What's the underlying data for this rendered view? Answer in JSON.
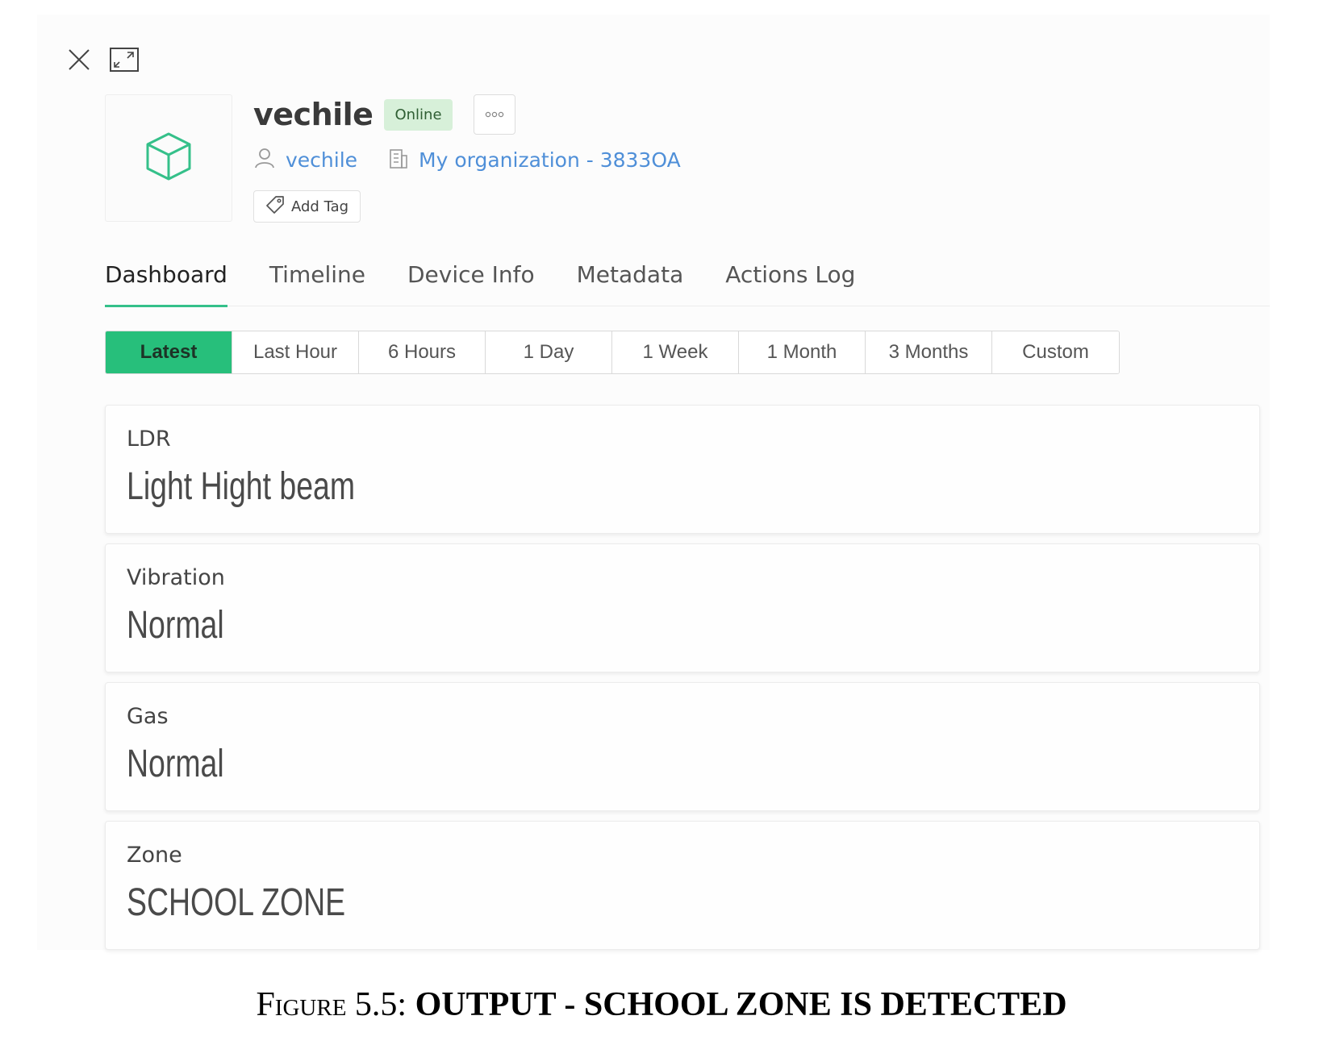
{
  "window": {
    "controls": [
      {
        "icon": "close-icon"
      },
      {
        "icon": "expand-icon"
      }
    ]
  },
  "device": {
    "icon": "cube-icon",
    "name": "vechile",
    "status": "Online",
    "more_icon": "more-icon",
    "owner": "vechile",
    "organization": "My organization - 3833OA",
    "add_tag": "Add Tag"
  },
  "tabs": [
    {
      "label": "Dashboard",
      "active": true
    },
    {
      "label": "Timeline",
      "active": false
    },
    {
      "label": "Device Info",
      "active": false
    },
    {
      "label": "Metadata",
      "active": false
    },
    {
      "label": "Actions Log",
      "active": false
    }
  ],
  "time_ranges": [
    {
      "label": "Latest",
      "active": true
    },
    {
      "label": "Last Hour",
      "active": false
    },
    {
      "label": "6 Hours",
      "active": false
    },
    {
      "label": "1 Day",
      "active": false
    },
    {
      "label": "1 Week",
      "active": false
    },
    {
      "label": "1 Month",
      "active": false
    },
    {
      "label": "3 Months",
      "active": false
    },
    {
      "label": "Custom",
      "active": false
    }
  ],
  "widgets": [
    {
      "label": "LDR",
      "value": "Light Hight beam"
    },
    {
      "label": "Vibration",
      "value": "Normal"
    },
    {
      "label": "Gas",
      "value": "Normal"
    },
    {
      "label": "Zone",
      "value": "SCHOOL ZONE"
    }
  ],
  "caption": {
    "figure": "Figure 5.5:",
    "text": "OUTPUT - SCHOOL ZONE IS DETECTED"
  },
  "colors": {
    "accent": "#27bf7b",
    "link": "#4f8fd8",
    "online_badge": "#d7f0d9"
  }
}
